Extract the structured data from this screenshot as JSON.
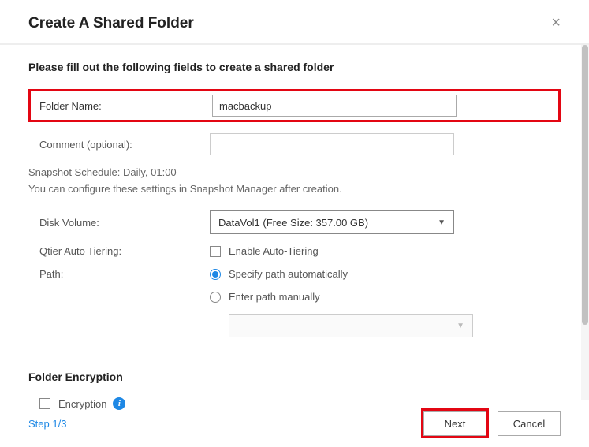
{
  "dialog": {
    "title": "Create A Shared Folder",
    "intro": "Please fill out the following fields to create a shared folder"
  },
  "fields": {
    "folder_name_label": "Folder Name:",
    "folder_name_value": "macbackup",
    "comment_label": "Comment (optional):",
    "comment_value": "",
    "snapshot_note": "Snapshot Schedule: Daily, 01:00",
    "snapshot_note2": "You can configure these settings in Snapshot Manager after creation.",
    "disk_volume_label": "Disk Volume:",
    "disk_volume_value": "DataVol1 (Free Size: 357.00 GB)",
    "qtier_label": "Qtier Auto Tiering:",
    "qtier_option": "Enable Auto-Tiering",
    "path_label": "Path:",
    "path_auto": "Specify path automatically",
    "path_manual": "Enter path manually",
    "manual_path_value": ""
  },
  "encryption": {
    "heading": "Folder Encryption",
    "checkbox_label": "Encryption"
  },
  "footer": {
    "step": "Step 1/3",
    "next": "Next",
    "cancel": "Cancel"
  }
}
